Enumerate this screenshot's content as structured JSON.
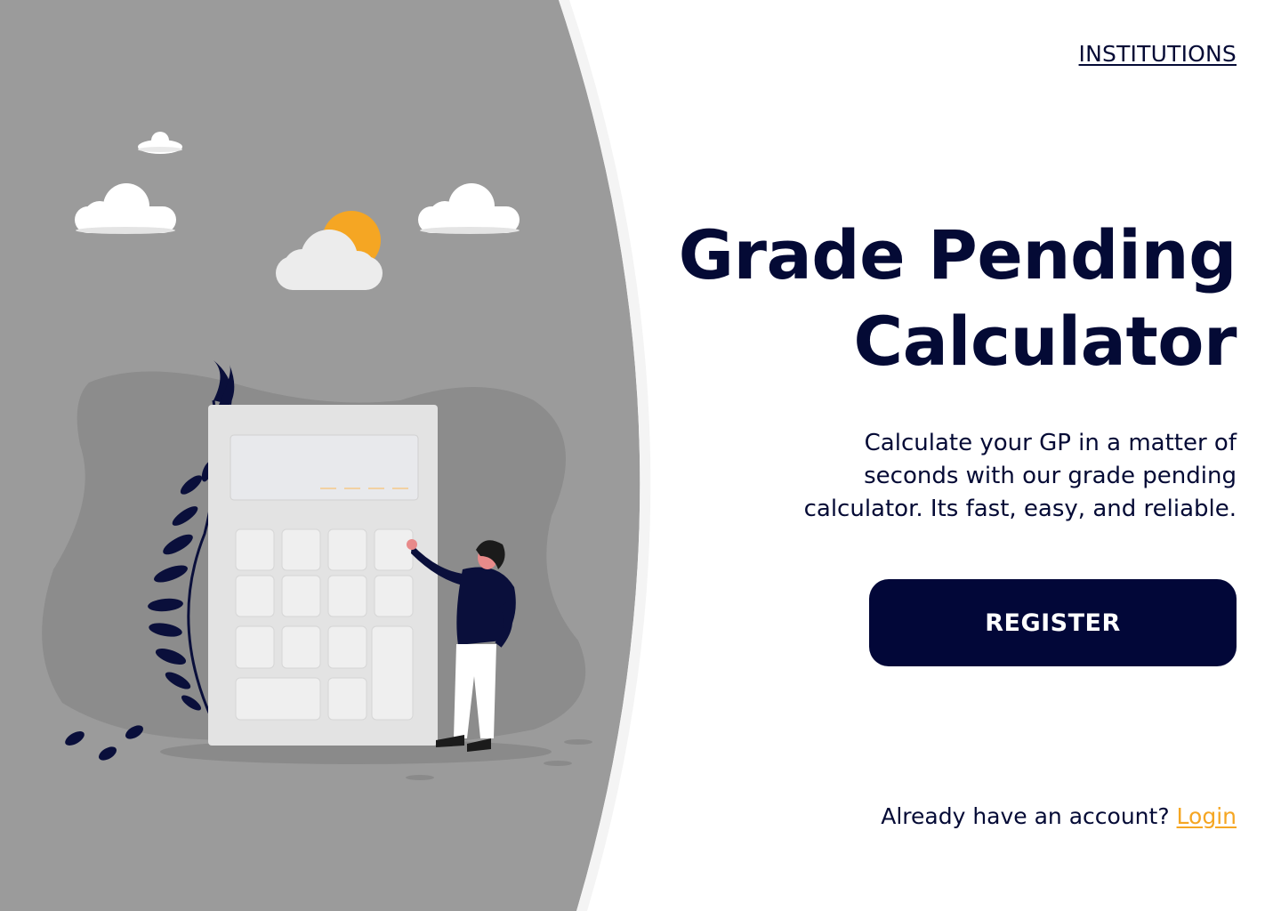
{
  "nav": {
    "institutions_label": "INSTITUTIONS"
  },
  "hero": {
    "title_line1": "Grade Pending",
    "title_line2": "Calculator",
    "subtitle_line1": "Calculate your GP in a matter of",
    "subtitle_line2": "seconds with our grade pending",
    "subtitle_line3": "calculator. Its fast, easy, and reliable."
  },
  "actions": {
    "register_label": "REGISTER",
    "login_prompt": "Already have an account?",
    "login_label": "Login"
  },
  "illustration": {
    "icons": [
      "cloud-icon",
      "sun-icon",
      "calculator-icon",
      "person-icon",
      "plant-icon",
      "leaf-icon"
    ]
  },
  "colors": {
    "navy": "#040a35",
    "button": "#020738",
    "accent": "#f5a623",
    "panel_gray": "#9b9b9b"
  }
}
